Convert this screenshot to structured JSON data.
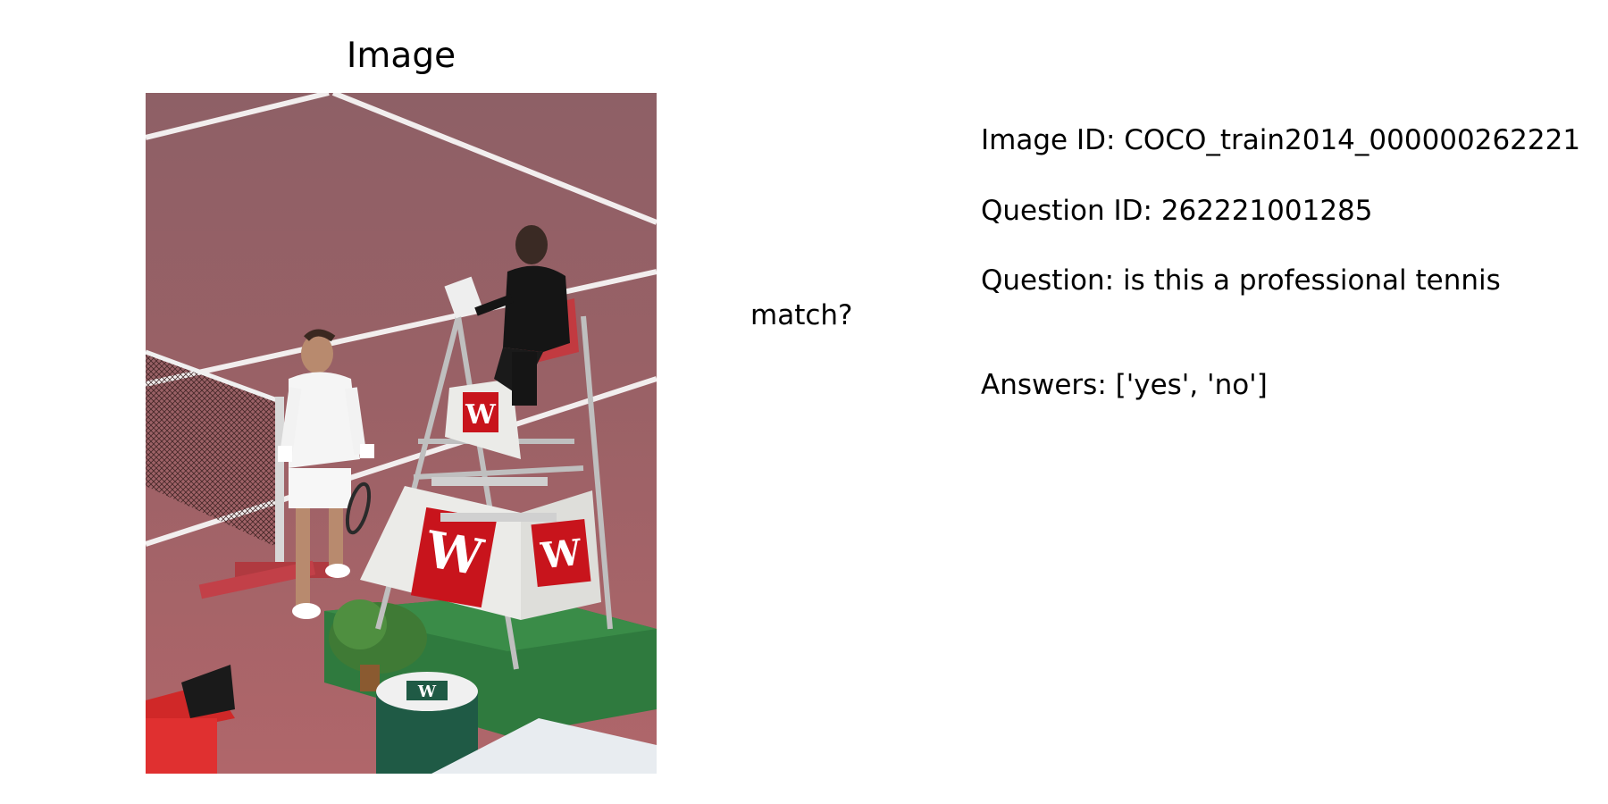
{
  "panel": {
    "title": "Image"
  },
  "photo": {
    "icon": "tennis-match-photo",
    "colors": {
      "court": "#a8656a",
      "upper_court": "#8f6167",
      "chair": "#e6e6e3",
      "wilson_red": "#c8141c",
      "grass": "#2f7a3e"
    }
  },
  "info": {
    "image_id": "Image ID: COCO_train2014_000000262221",
    "question_id": "Question ID: 262221001285",
    "question": "Question: is this a professional tennis match?",
    "answers": "Answers: ['yes', 'no']"
  }
}
